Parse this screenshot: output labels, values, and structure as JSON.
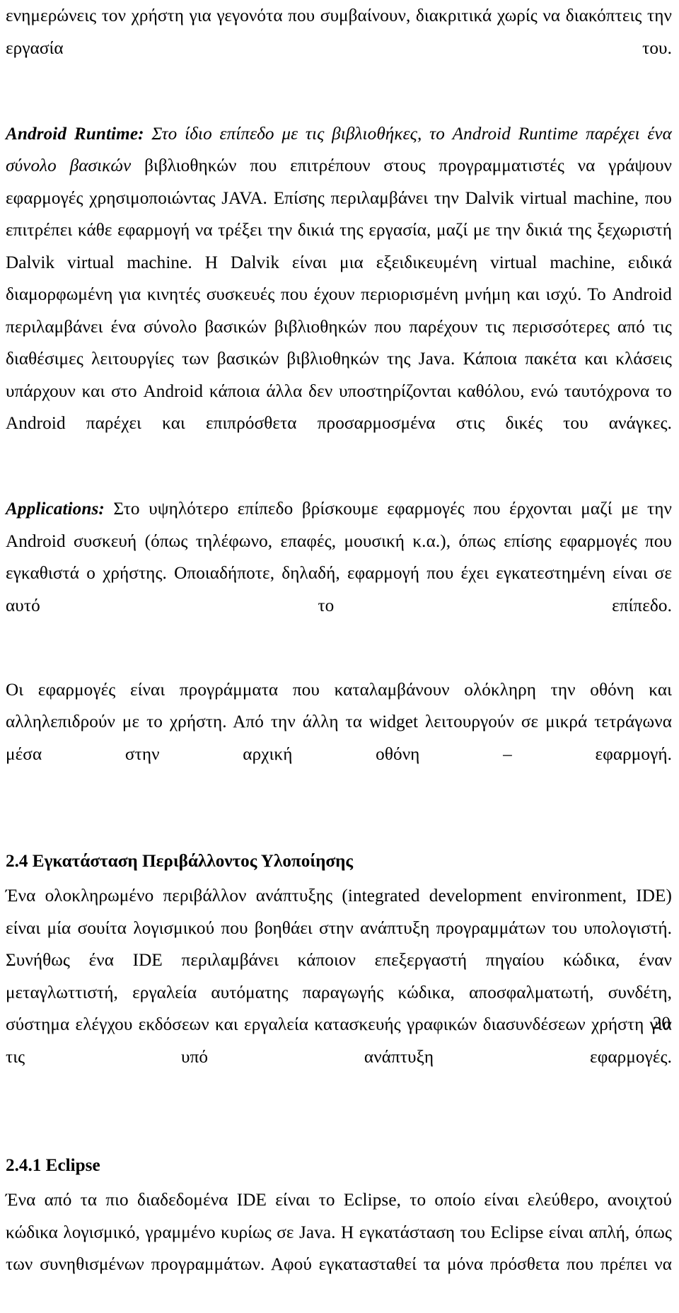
{
  "document": {
    "page_number": "20",
    "paragraphs": [
      {
        "id": "intro",
        "text": "ενημερώνεις τον χρήστη για γεγονότα που συμβαίνουν, διακριτικά χωρίς να διακόπτεις την εργασία του."
      },
      {
        "id": "android-runtime",
        "lead": "Android Runtime:",
        "italic_run": " Στο ίδιο επίπεδο με τις βιβλιοθήκες, το Android Runtime παρέχει ένα σύνολο βασικών ",
        "text": "βιβλιοθηκών που επιτρέπουν στους προγραμματιστές να γράψουν εφαρμογές χρησιμοποιώντας JAVA. Επίσης περιλαμβάνει την Dalvik virtual machine, που επιτρέπει κάθε εφαρμογή να τρέξει την δικιά της εργασία, μαζί με την δικιά της ξεχωριστή Dalvik virtual machine. Η Dalvik είναι μια εξειδικευμένη virtual machine, ειδικά διαμορφωμένη για κινητές συσκευές που έχουν περιορισμένη μνήμη και ισχύ. Το Android περιλαμβάνει ένα σύνολο βασικών βιβλιοθηκών που παρέχουν τις περισσότερες από τις διαθέσιμες λειτουργίες των βασικών βιβλιοθηκών της Java. Κάποια πακέτα και κλάσεις υπάρχουν και στο Android κάποια άλλα δεν υποστηρίζονται καθόλου, ενώ ταυτόχρονα το Android παρέχει και επιπρόσθετα προσαρμοσμένα στις δικές του ανάγκες."
      },
      {
        "id": "applications",
        "lead": "Applications:",
        "text": " Στο υψηλότερο επίπεδο βρίσκουμε εφαρμογές που έρχονται μαζί με την Android συσκευή (όπως τηλέφωνο, επαφές, μουσική κ.α.), όπως επίσης εφαρμογές που εγκαθιστά ο χρήστης. Οποιαδήποτε, δηλαδή, εφαρμογή που έχει εγκατεστημένη είναι σε αυτό το επίπεδο."
      },
      {
        "id": "apps-description",
        "text": "Οι εφαρμογές είναι προγράμματα που καταλαμβάνουν ολόκληρη την οθόνη και αλληλεπιδρούν με το χρήστη. Από την άλλη τα widget λειτουργούν σε μικρά τετράγωνα μέσα στην αρχική οθόνη – εφαρμογή."
      }
    ],
    "sections": [
      {
        "id": "section-2-4",
        "heading": "2.4 Εγκατάσταση  Περιβάλλοντος Υλοποίησης",
        "body": "Ένα ολοκληρωμένο περιβάλλον ανάπτυξης (integrated development environment, IDE) είναι μία σουίτα λογισμικού που βοηθάει στην ανάπτυξη προγραμμάτων του υπολογιστή. Συνήθως ένα IDE περιλαμβάνει κάποιον επεξεργαστή πηγαίου κώδικα, έναν μεταγλωττιστή, εργαλεία αυτόματης παραγωγής κώδικα, αποσφαλματωτή, συνδέτη, σύστημα ελέγχου εκδόσεων και εργαλεία κατασκευής γραφικών διασυνδέσεων χρήστη για τις υπό ανάπτυξη εφαρμογές."
      },
      {
        "id": "section-2-4-1",
        "heading": "2.4.1 Eclipse",
        "body": "Ένα από τα πιο διαδεδομένα IDE είναι το Eclipse, το οποίο είναι ελεύθερο, ανοιχτού κώδικα λογισμικό, γραμμένο κυρίως σε Java. Η εγκατάσταση του Eclipse είναι απλή, όπως των συνηθισμένων προγραμμάτων. Αφού εγκατασταθεί τα μόνα πρόσθετα που πρέπει να"
      }
    ]
  }
}
